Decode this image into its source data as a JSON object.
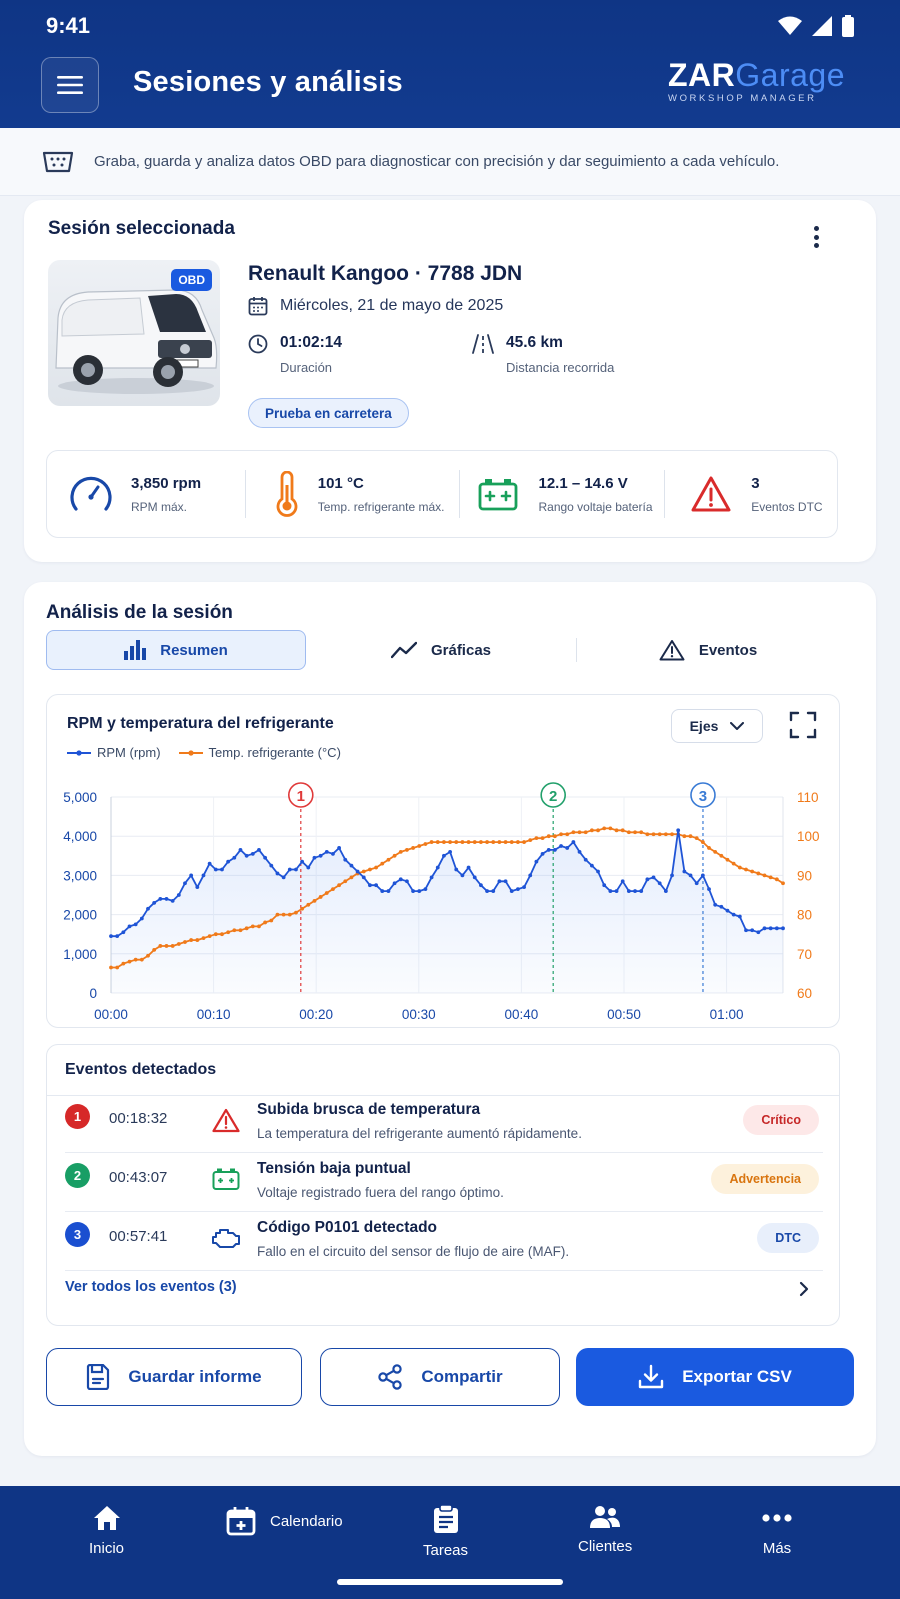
{
  "status_bar": {
    "time": "9:41"
  },
  "header": {
    "title": "Sesiones y análisis",
    "logo_main": "ZAR",
    "logo_accent": "Garage",
    "logo_sub": "WORKSHOP MANAGER"
  },
  "info": {
    "text": "Graba, guarda y analiza datos OBD para diagnosticar con precisión y dar seguimiento a cada vehículo."
  },
  "session": {
    "section_title": "Sesión seleccionada",
    "badge": "OBD",
    "vehicle": "Renault Kangoo · 7788 JDN",
    "date": "Miércoles, 21 de mayo de 2025",
    "duration_value": "01:02:14",
    "duration_label": "Duración",
    "distance_value": "45.6 km",
    "distance_label": "Distancia recorrida",
    "tag": "Prueba en carretera",
    "stats": [
      {
        "value": "3,850 rpm",
        "label": "RPM máx.",
        "icon": "gauge-icon",
        "color": "#1848a8"
      },
      {
        "value": "101 °C",
        "label": "Temp. refrigerante máx.",
        "icon": "thermometer-icon",
        "color": "#f07a1a"
      },
      {
        "value": "12.1 – 14.6 V",
        "label": "Rango voltaje batería",
        "icon": "battery-icon",
        "color": "#18a05a"
      },
      {
        "value": "3",
        "label": "Eventos DTC",
        "icon": "warning-icon",
        "color": "#d92b2b"
      }
    ]
  },
  "analysis": {
    "section_title": "Análisis de la sesión",
    "tabs": [
      {
        "label": "Resumen",
        "active": true
      },
      {
        "label": "Gráficas",
        "active": false
      },
      {
        "label": "Eventos",
        "active": false
      }
    ],
    "axes_button": "Ejes"
  },
  "chart_data": {
    "type": "line",
    "title": "RPM y temperatura del refrigerante",
    "x_ticks": [
      "00:00",
      "00:10",
      "00:20",
      "00:30",
      "00:40",
      "00:50",
      "01:00"
    ],
    "x_range_min": [
      0,
      65.5
    ],
    "y_left_ticks": [
      "0",
      "1,000",
      "2,000",
      "3,000",
      "4,000",
      "5,000"
    ],
    "y_left_range": [
      0,
      5000
    ],
    "y_right_ticks": [
      "60",
      "70",
      "80",
      "90",
      "100",
      "110"
    ],
    "y_right_range": [
      60,
      110
    ],
    "grid": true,
    "legend": "top-left",
    "series": [
      {
        "name": "RPM (rpm)",
        "axis": "left",
        "color": "#1f54d6",
        "points": [
          [
            0,
            1450
          ],
          [
            1,
            1450
          ],
          [
            2,
            1550
          ],
          [
            3,
            1700
          ],
          [
            4,
            1750
          ],
          [
            5,
            1900
          ],
          [
            6,
            2150
          ],
          [
            7,
            2300
          ],
          [
            8,
            2400
          ],
          [
            9,
            2400
          ],
          [
            10,
            2350
          ],
          [
            11,
            2500
          ],
          [
            12,
            2800
          ],
          [
            13,
            3000
          ],
          [
            14,
            2700
          ],
          [
            15,
            3000
          ],
          [
            16,
            3300
          ],
          [
            17,
            3150
          ],
          [
            18,
            3150
          ],
          [
            19,
            3350
          ],
          [
            20,
            3450
          ],
          [
            21,
            3650
          ],
          [
            22,
            3500
          ],
          [
            23,
            3550
          ],
          [
            24,
            3650
          ],
          [
            25,
            3450
          ],
          [
            26,
            3250
          ],
          [
            27,
            3050
          ],
          [
            28,
            2950
          ],
          [
            29,
            3150
          ],
          [
            30,
            3150
          ],
          [
            31,
            3350
          ],
          [
            32,
            3200
          ],
          [
            33,
            3450
          ],
          [
            34,
            3500
          ],
          [
            35,
            3600
          ],
          [
            36,
            3550
          ],
          [
            37,
            3700
          ],
          [
            38,
            3400
          ],
          [
            39,
            3250
          ],
          [
            40,
            3100
          ],
          [
            41,
            2950
          ],
          [
            42,
            2750
          ],
          [
            43,
            2750
          ],
          [
            44,
            2600
          ],
          [
            45,
            2600
          ],
          [
            46,
            2800
          ],
          [
            47,
            2900
          ],
          [
            48,
            2850
          ],
          [
            49,
            2600
          ],
          [
            50,
            2600
          ],
          [
            51,
            2650
          ],
          [
            52,
            2950
          ],
          [
            53,
            3200
          ],
          [
            54,
            3500
          ],
          [
            55,
            3600
          ],
          [
            56,
            3150
          ],
          [
            57,
            3000
          ],
          [
            58,
            3200
          ],
          [
            59,
            2950
          ],
          [
            60,
            2750
          ],
          [
            61,
            2600
          ],
          [
            62,
            2600
          ],
          [
            63,
            2850
          ],
          [
            64,
            2850
          ],
          [
            65,
            2600
          ],
          [
            66,
            2650
          ],
          [
            67,
            2700
          ],
          [
            68,
            3000
          ],
          [
            69,
            3350
          ],
          [
            70,
            3550
          ],
          [
            71,
            3650
          ],
          [
            72,
            3650
          ],
          [
            73,
            3750
          ],
          [
            74,
            3700
          ],
          [
            75,
            3850
          ],
          [
            76,
            3600
          ],
          [
            77,
            3400
          ],
          [
            78,
            3250
          ],
          [
            79,
            3100
          ],
          [
            80,
            2750
          ],
          [
            81,
            2600
          ],
          [
            82,
            2600
          ],
          [
            83,
            2850
          ],
          [
            84,
            2600
          ],
          [
            85,
            2600
          ],
          [
            86,
            2600
          ],
          [
            87,
            2900
          ],
          [
            88,
            2950
          ],
          [
            89,
            2800
          ],
          [
            90,
            2600
          ],
          [
            91,
            3000
          ],
          [
            92,
            4150
          ],
          [
            93,
            3100
          ],
          [
            94,
            3000
          ],
          [
            95,
            2800
          ],
          [
            96,
            3000
          ],
          [
            97,
            2650
          ],
          [
            98,
            2250
          ],
          [
            99,
            2200
          ],
          [
            100,
            2100
          ],
          [
            101,
            2000
          ],
          [
            102,
            1950
          ],
          [
            103,
            1600
          ],
          [
            104,
            1600
          ],
          [
            105,
            1550
          ],
          [
            106,
            1650
          ],
          [
            107,
            1650
          ],
          [
            108,
            1650
          ],
          [
            109,
            1650
          ]
        ],
        "x_unit": "index (0–109 spans 00:00–01:05)"
      },
      {
        "name": "Temp. refrigerante (°C)",
        "axis": "right",
        "color": "#f07a1a",
        "points": [
          [
            0,
            66.5
          ],
          [
            1,
            66.5
          ],
          [
            2,
            67.5
          ],
          [
            3,
            68
          ],
          [
            4,
            68.5
          ],
          [
            5,
            68.5
          ],
          [
            6,
            69.5
          ],
          [
            7,
            71
          ],
          [
            8,
            72
          ],
          [
            9,
            72
          ],
          [
            10,
            72
          ],
          [
            11,
            72.5
          ],
          [
            12,
            73
          ],
          [
            13,
            73.5
          ],
          [
            14,
            73.5
          ],
          [
            15,
            74
          ],
          [
            16,
            74.5
          ],
          [
            17,
            75
          ],
          [
            18,
            75
          ],
          [
            19,
            75.5
          ],
          [
            20,
            76
          ],
          [
            21,
            76
          ],
          [
            22,
            76.5
          ],
          [
            23,
            77
          ],
          [
            24,
            77
          ],
          [
            25,
            78
          ],
          [
            26,
            78.5
          ],
          [
            27,
            80
          ],
          [
            28,
            80
          ],
          [
            29,
            80
          ],
          [
            30,
            80.5
          ],
          [
            31,
            81.5
          ],
          [
            32,
            82.5
          ],
          [
            33,
            83.5
          ],
          [
            34,
            84.5
          ],
          [
            35,
            85.5
          ],
          [
            36,
            86.5
          ],
          [
            37,
            87.5
          ],
          [
            38,
            88.5
          ],
          [
            39,
            89.5
          ],
          [
            40,
            90.5
          ],
          [
            41,
            91
          ],
          [
            42,
            91.5
          ],
          [
            43,
            92
          ],
          [
            44,
            93
          ],
          [
            45,
            94
          ],
          [
            46,
            95
          ],
          [
            47,
            96
          ],
          [
            48,
            96.5
          ],
          [
            49,
            97
          ],
          [
            50,
            97.5
          ],
          [
            51,
            98
          ],
          [
            52,
            98.5
          ],
          [
            53,
            98.5
          ],
          [
            54,
            98.5
          ],
          [
            55,
            98.5
          ],
          [
            56,
            98.5
          ],
          [
            57,
            98.5
          ],
          [
            58,
            98.5
          ],
          [
            59,
            98.5
          ],
          [
            60,
            98.5
          ],
          [
            61,
            98.5
          ],
          [
            62,
            98.5
          ],
          [
            63,
            98.5
          ],
          [
            64,
            98.5
          ],
          [
            65,
            98.5
          ],
          [
            66,
            98.5
          ],
          [
            67,
            98.5
          ],
          [
            68,
            99
          ],
          [
            69,
            99.5
          ],
          [
            70,
            99.5
          ],
          [
            71,
            100
          ],
          [
            72,
            100
          ],
          [
            73,
            100.5
          ],
          [
            74,
            100.5
          ],
          [
            75,
            101
          ],
          [
            76,
            101
          ],
          [
            77,
            101
          ],
          [
            78,
            101.5
          ],
          [
            79,
            101.5
          ],
          [
            80,
            102
          ],
          [
            81,
            102
          ],
          [
            82,
            101.5
          ],
          [
            83,
            101.5
          ],
          [
            84,
            101
          ],
          [
            85,
            101
          ],
          [
            86,
            101
          ],
          [
            87,
            100.5
          ],
          [
            88,
            100.5
          ],
          [
            89,
            100.5
          ],
          [
            90,
            100.5
          ],
          [
            91,
            100.5
          ],
          [
            92,
            100.5
          ],
          [
            93,
            100
          ],
          [
            94,
            100
          ],
          [
            95,
            99.5
          ],
          [
            96,
            98.5
          ],
          [
            97,
            97
          ],
          [
            98,
            96
          ],
          [
            99,
            95
          ],
          [
            100,
            94
          ],
          [
            101,
            93
          ],
          [
            102,
            92
          ],
          [
            103,
            91.5
          ],
          [
            104,
            91
          ],
          [
            105,
            90.5
          ],
          [
            106,
            90
          ],
          [
            107,
            89.5
          ],
          [
            108,
            89
          ],
          [
            109,
            88
          ]
        ]
      }
    ],
    "markers": [
      {
        "label": "1",
        "x": 18.5,
        "color": "#e03a3a"
      },
      {
        "label": "2",
        "x": 43.1,
        "color": "#22a06b"
      },
      {
        "label": "3",
        "x": 57.7,
        "color": "#3a7bd5"
      }
    ]
  },
  "events": {
    "title": "Eventos detectados",
    "items": [
      {
        "num": "1",
        "time": "00:18:32",
        "title": "Subida brusca de temperatura",
        "desc": "La temperatura del refrigerante aumentó rápidamente.",
        "badge": "Crítico",
        "num_color": "#d62828",
        "badge_bg": "#fde8e8",
        "badge_fg": "#c62828",
        "icon": "warning-icon"
      },
      {
        "num": "2",
        "time": "00:43:07",
        "title": "Tensión baja puntual",
        "desc": "Voltaje registrado fuera del rango óptimo.",
        "badge": "Advertencia",
        "num_color": "#189e65",
        "badge_bg": "#fdf1dc",
        "badge_fg": "#d9750f",
        "icon": "battery-icon"
      },
      {
        "num": "3",
        "time": "00:57:41",
        "title": "Código P0101 detectado",
        "desc": "Fallo en el circuito del sensor de flujo de aire (MAF).",
        "badge": "DTC",
        "num_color": "#1a4fd0",
        "badge_bg": "#e8effb",
        "badge_fg": "#1848a8",
        "icon": "engine-icon"
      }
    ],
    "see_all": "Ver todos los eventos (3)"
  },
  "actions": {
    "save": "Guardar informe",
    "share": "Compartir",
    "export": "Exportar CSV"
  },
  "bottom_nav": [
    {
      "label": "Inicio",
      "icon": "home-icon"
    },
    {
      "label": "Calendario",
      "icon": "calendar-icon"
    },
    {
      "label": "Tareas",
      "icon": "clipboard-icon"
    },
    {
      "label": "Clientes",
      "icon": "people-icon"
    },
    {
      "label": "Más",
      "icon": "more-icon"
    }
  ]
}
